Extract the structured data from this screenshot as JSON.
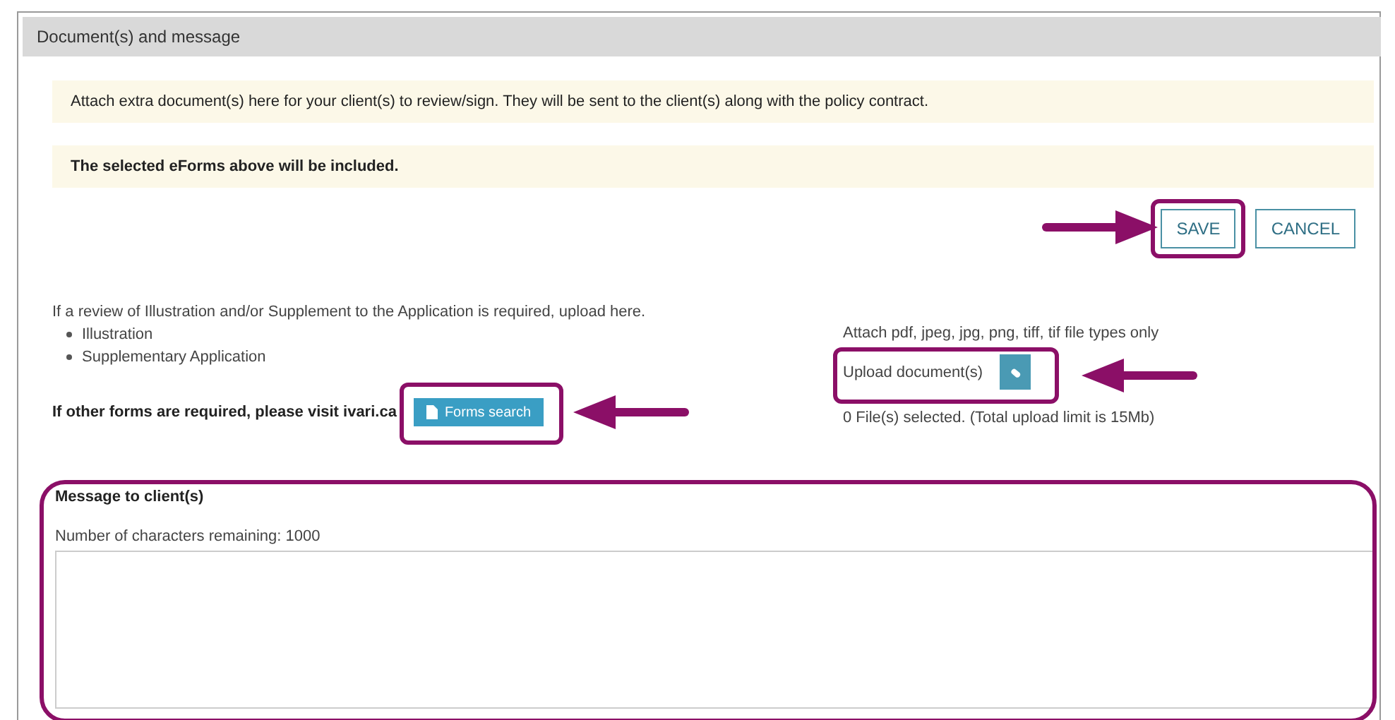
{
  "panel": {
    "title": "Document(s) and message"
  },
  "notices": [
    {
      "text": "Attach extra document(s) here for your client(s) to review/sign. They will be sent to the client(s) along with the policy contract.",
      "bold": false
    },
    {
      "text": "The selected eForms above will be included.",
      "bold": true
    }
  ],
  "buttons": [
    {
      "label": "SAVE",
      "highlighted": true
    },
    {
      "label": "CANCEL",
      "highlighted": false
    }
  ],
  "review": {
    "intro": "If a review of Illustration and/or Supplement to the Application is required, upload here.",
    "items": [
      "Illustration",
      "Supplementary Application"
    ],
    "other_forms": "If other forms are required, please visit ivari.ca",
    "forms_button": "Forms search"
  },
  "upload": {
    "types_note": "Attach pdf, jpeg, jpg, png, tiff, tif file types only",
    "label": "Upload document(s)",
    "status": "0 File(s) selected. (Total upload limit is 15Mb)"
  },
  "message": {
    "title": "Message to client(s)",
    "remaining": "Number of characters remaining: 1000"
  }
}
